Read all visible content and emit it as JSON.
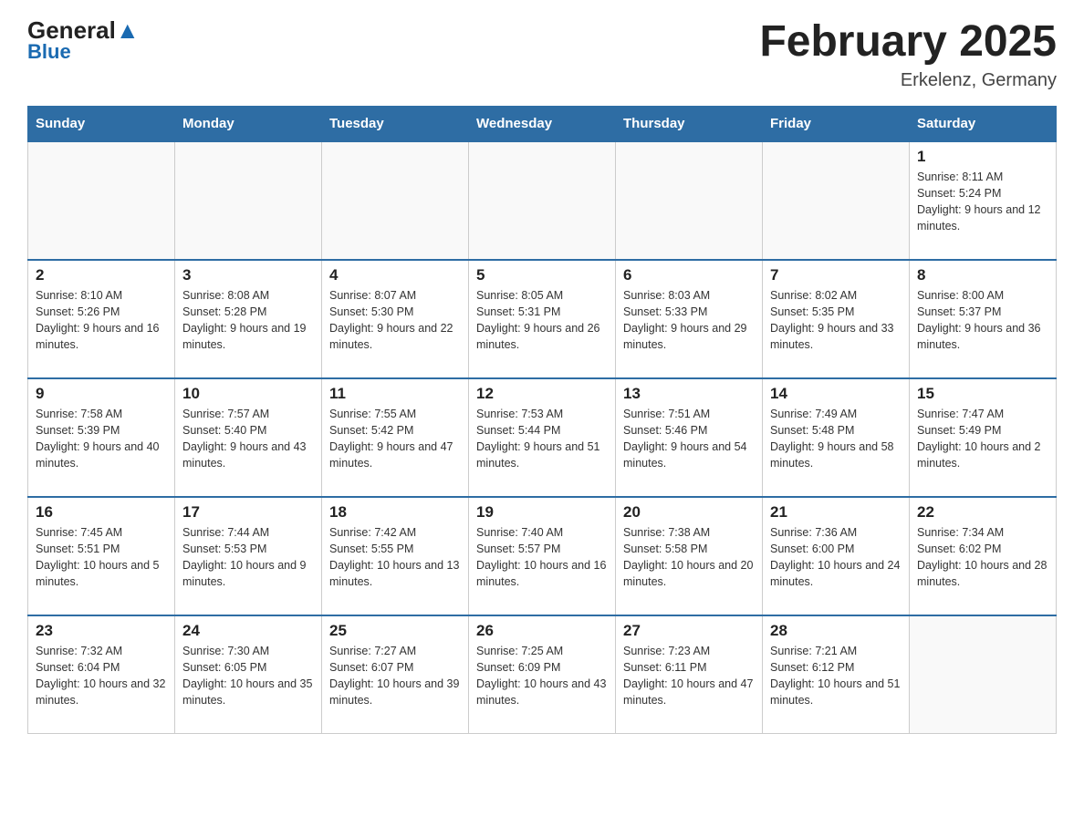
{
  "header": {
    "logo_top": "General",
    "logo_bottom": "Blue",
    "month_title": "February 2025",
    "location": "Erkelenz, Germany"
  },
  "days_of_week": [
    "Sunday",
    "Monday",
    "Tuesday",
    "Wednesday",
    "Thursday",
    "Friday",
    "Saturday"
  ],
  "weeks": [
    [
      {
        "num": "",
        "info": ""
      },
      {
        "num": "",
        "info": ""
      },
      {
        "num": "",
        "info": ""
      },
      {
        "num": "",
        "info": ""
      },
      {
        "num": "",
        "info": ""
      },
      {
        "num": "",
        "info": ""
      },
      {
        "num": "1",
        "info": "Sunrise: 8:11 AM\nSunset: 5:24 PM\nDaylight: 9 hours and 12 minutes."
      }
    ],
    [
      {
        "num": "2",
        "info": "Sunrise: 8:10 AM\nSunset: 5:26 PM\nDaylight: 9 hours and 16 minutes."
      },
      {
        "num": "3",
        "info": "Sunrise: 8:08 AM\nSunset: 5:28 PM\nDaylight: 9 hours and 19 minutes."
      },
      {
        "num": "4",
        "info": "Sunrise: 8:07 AM\nSunset: 5:30 PM\nDaylight: 9 hours and 22 minutes."
      },
      {
        "num": "5",
        "info": "Sunrise: 8:05 AM\nSunset: 5:31 PM\nDaylight: 9 hours and 26 minutes."
      },
      {
        "num": "6",
        "info": "Sunrise: 8:03 AM\nSunset: 5:33 PM\nDaylight: 9 hours and 29 minutes."
      },
      {
        "num": "7",
        "info": "Sunrise: 8:02 AM\nSunset: 5:35 PM\nDaylight: 9 hours and 33 minutes."
      },
      {
        "num": "8",
        "info": "Sunrise: 8:00 AM\nSunset: 5:37 PM\nDaylight: 9 hours and 36 minutes."
      }
    ],
    [
      {
        "num": "9",
        "info": "Sunrise: 7:58 AM\nSunset: 5:39 PM\nDaylight: 9 hours and 40 minutes."
      },
      {
        "num": "10",
        "info": "Sunrise: 7:57 AM\nSunset: 5:40 PM\nDaylight: 9 hours and 43 minutes."
      },
      {
        "num": "11",
        "info": "Sunrise: 7:55 AM\nSunset: 5:42 PM\nDaylight: 9 hours and 47 minutes."
      },
      {
        "num": "12",
        "info": "Sunrise: 7:53 AM\nSunset: 5:44 PM\nDaylight: 9 hours and 51 minutes."
      },
      {
        "num": "13",
        "info": "Sunrise: 7:51 AM\nSunset: 5:46 PM\nDaylight: 9 hours and 54 minutes."
      },
      {
        "num": "14",
        "info": "Sunrise: 7:49 AM\nSunset: 5:48 PM\nDaylight: 9 hours and 58 minutes."
      },
      {
        "num": "15",
        "info": "Sunrise: 7:47 AM\nSunset: 5:49 PM\nDaylight: 10 hours and 2 minutes."
      }
    ],
    [
      {
        "num": "16",
        "info": "Sunrise: 7:45 AM\nSunset: 5:51 PM\nDaylight: 10 hours and 5 minutes."
      },
      {
        "num": "17",
        "info": "Sunrise: 7:44 AM\nSunset: 5:53 PM\nDaylight: 10 hours and 9 minutes."
      },
      {
        "num": "18",
        "info": "Sunrise: 7:42 AM\nSunset: 5:55 PM\nDaylight: 10 hours and 13 minutes."
      },
      {
        "num": "19",
        "info": "Sunrise: 7:40 AM\nSunset: 5:57 PM\nDaylight: 10 hours and 16 minutes."
      },
      {
        "num": "20",
        "info": "Sunrise: 7:38 AM\nSunset: 5:58 PM\nDaylight: 10 hours and 20 minutes."
      },
      {
        "num": "21",
        "info": "Sunrise: 7:36 AM\nSunset: 6:00 PM\nDaylight: 10 hours and 24 minutes."
      },
      {
        "num": "22",
        "info": "Sunrise: 7:34 AM\nSunset: 6:02 PM\nDaylight: 10 hours and 28 minutes."
      }
    ],
    [
      {
        "num": "23",
        "info": "Sunrise: 7:32 AM\nSunset: 6:04 PM\nDaylight: 10 hours and 32 minutes."
      },
      {
        "num": "24",
        "info": "Sunrise: 7:30 AM\nSunset: 6:05 PM\nDaylight: 10 hours and 35 minutes."
      },
      {
        "num": "25",
        "info": "Sunrise: 7:27 AM\nSunset: 6:07 PM\nDaylight: 10 hours and 39 minutes."
      },
      {
        "num": "26",
        "info": "Sunrise: 7:25 AM\nSunset: 6:09 PM\nDaylight: 10 hours and 43 minutes."
      },
      {
        "num": "27",
        "info": "Sunrise: 7:23 AM\nSunset: 6:11 PM\nDaylight: 10 hours and 47 minutes."
      },
      {
        "num": "28",
        "info": "Sunrise: 7:21 AM\nSunset: 6:12 PM\nDaylight: 10 hours and 51 minutes."
      },
      {
        "num": "",
        "info": ""
      }
    ]
  ]
}
